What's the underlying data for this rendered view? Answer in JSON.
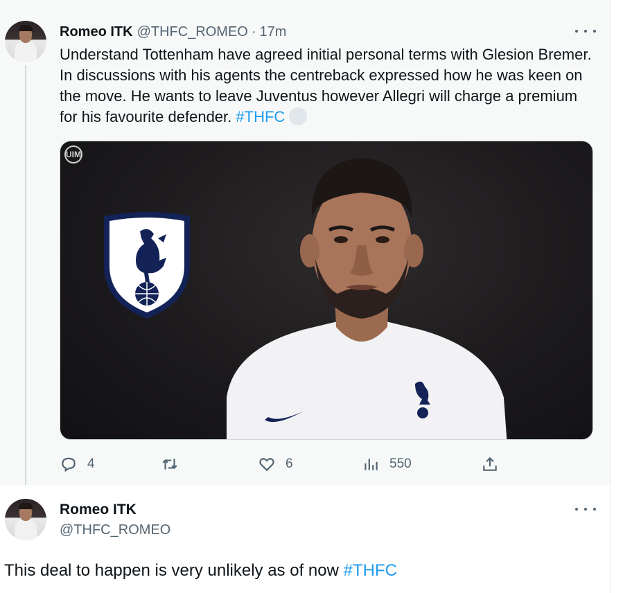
{
  "tweet1": {
    "author_name": "Romeo ITK",
    "handle": "@THFC_ROMEO",
    "separator": "·",
    "time": "17m",
    "text": "Understand Tottenham have agreed initial personal terms with Glesion Bremer. In discussions with his agents the centreback expressed how he was keen on the move. He wants to leave Juventus however Allegri will charge a premium for his favourite defender.",
    "hashtag": "#THFC",
    "media_watermark": "UIM",
    "actions": {
      "reply_count": "4",
      "retweet_count": "",
      "like_count": "6",
      "views_count": "550"
    },
    "icons": [
      "more-icon",
      "reply-icon",
      "retweet-icon",
      "like-icon",
      "views-icon",
      "share-icon"
    ]
  },
  "tweet2": {
    "author_name": "Romeo ITK",
    "handle": "@THFC_ROMEO",
    "text": "This deal to happen is very unlikely as of now",
    "hashtag": "#THFC"
  },
  "colors": {
    "text_primary": "#0f1419",
    "text_secondary": "#536471",
    "link": "#1d9bf0",
    "highlight_bg": "#f7f9f9",
    "spurs_navy": "#132257"
  }
}
